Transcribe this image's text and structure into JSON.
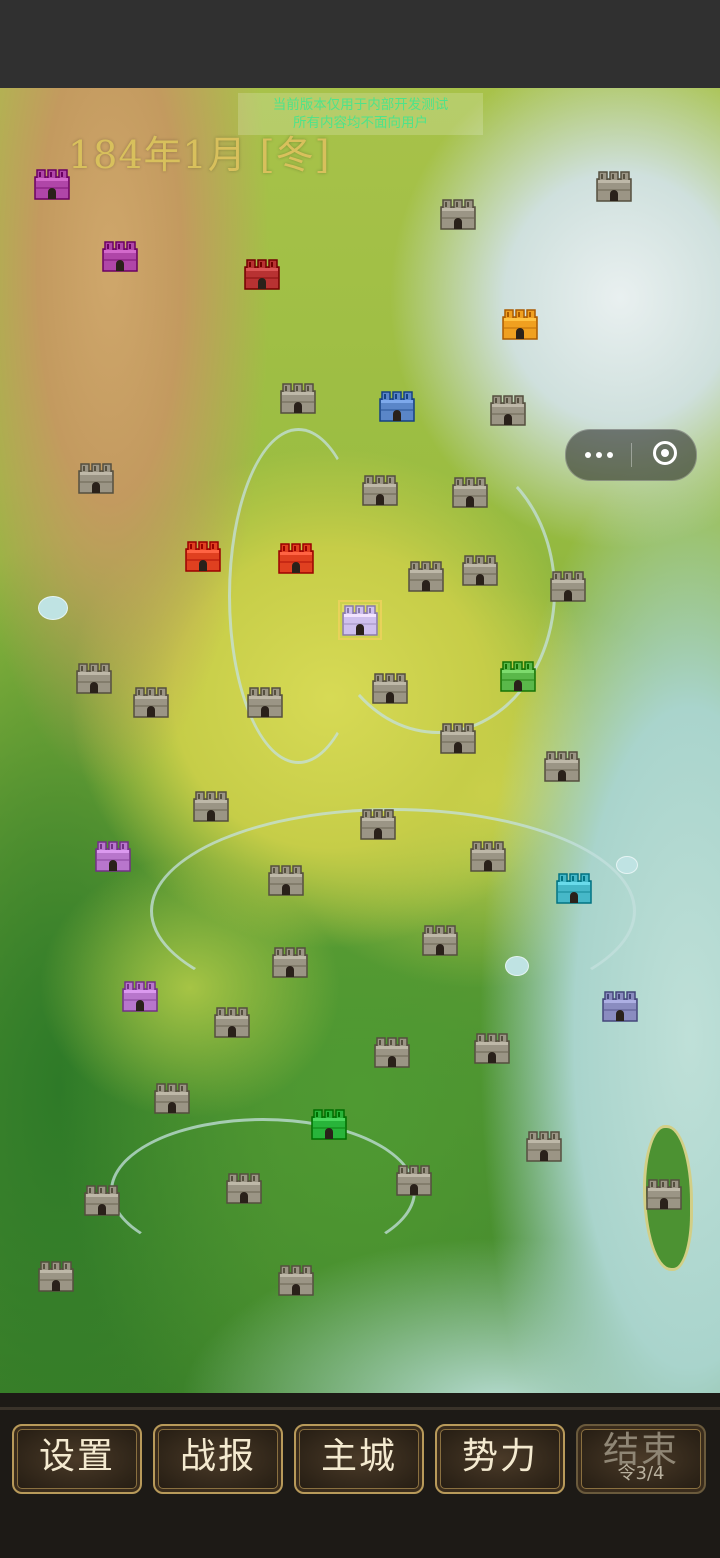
{
  "header": {
    "date": "184年1月 [冬]",
    "notice_line1": "当前版本仅用于内部开发测试",
    "notice_line2": "所有内容均不面向用户"
  },
  "colors": {
    "neutral": "#9b9585",
    "magenta": "#b046a8",
    "crimson": "#b83232",
    "orange": "#f0a020",
    "blue": "#5a86c8",
    "red": "#e04020",
    "lavender_selected": "#cfc0ee",
    "green": "#5ab84a",
    "violet": "#b876cc",
    "cyan": "#46b8c8",
    "slate": "#8a8cc0",
    "bright_green": "#28b43a"
  },
  "capsule": {
    "more_icon": "more-dots-icon",
    "close_icon": "target-circle-icon"
  },
  "cities": [
    {
      "id": "c1",
      "color": "magenta"
    },
    {
      "id": "c2",
      "color": "neutral"
    },
    {
      "id": "c3",
      "color": "neutral"
    },
    {
      "id": "c4",
      "color": "magenta"
    },
    {
      "id": "c5",
      "color": "crimson"
    },
    {
      "id": "c6",
      "color": "orange"
    },
    {
      "id": "c7",
      "color": "neutral"
    },
    {
      "id": "c8",
      "color": "blue"
    },
    {
      "id": "c9",
      "color": "neutral"
    },
    {
      "id": "c10",
      "color": "neutral"
    },
    {
      "id": "c11",
      "color": "neutral"
    },
    {
      "id": "c12",
      "color": "neutral"
    },
    {
      "id": "c13",
      "color": "red"
    },
    {
      "id": "c14",
      "color": "red"
    },
    {
      "id": "c15",
      "color": "neutral"
    },
    {
      "id": "c16",
      "color": "neutral"
    },
    {
      "id": "c17",
      "color": "neutral"
    },
    {
      "id": "c18",
      "color": "lavender_selected",
      "selected": true
    },
    {
      "id": "c19",
      "color": "neutral"
    },
    {
      "id": "c20",
      "color": "neutral"
    },
    {
      "id": "c21",
      "color": "neutral"
    },
    {
      "id": "c22",
      "color": "neutral"
    },
    {
      "id": "c23",
      "color": "green"
    },
    {
      "id": "c24",
      "color": "neutral"
    },
    {
      "id": "c25",
      "color": "neutral"
    },
    {
      "id": "c26",
      "color": "neutral"
    },
    {
      "id": "c27",
      "color": "neutral"
    },
    {
      "id": "c28",
      "color": "violet"
    },
    {
      "id": "c29",
      "color": "neutral"
    },
    {
      "id": "c30",
      "color": "neutral"
    },
    {
      "id": "c31",
      "color": "cyan"
    },
    {
      "id": "c32",
      "color": "neutral"
    },
    {
      "id": "c33",
      "color": "neutral"
    },
    {
      "id": "c34",
      "color": "violet"
    },
    {
      "id": "c35",
      "color": "slate"
    },
    {
      "id": "c36",
      "color": "neutral"
    },
    {
      "id": "c37",
      "color": "neutral"
    },
    {
      "id": "c38",
      "color": "neutral"
    },
    {
      "id": "c39",
      "color": "neutral"
    },
    {
      "id": "c40",
      "color": "bright_green"
    },
    {
      "id": "c41",
      "color": "neutral"
    },
    {
      "id": "c42",
      "color": "neutral"
    },
    {
      "id": "c43",
      "color": "neutral"
    },
    {
      "id": "c44",
      "color": "neutral"
    },
    {
      "id": "c45",
      "color": "neutral"
    },
    {
      "id": "c46",
      "color": "neutral"
    },
    {
      "id": "c47",
      "color": "neutral"
    }
  ],
  "buttons": {
    "settings": "设置",
    "battle_report": "战报",
    "main_city": "主城",
    "forces": "势力",
    "end_turn": "结束",
    "end_turn_sub": "令3/4"
  }
}
